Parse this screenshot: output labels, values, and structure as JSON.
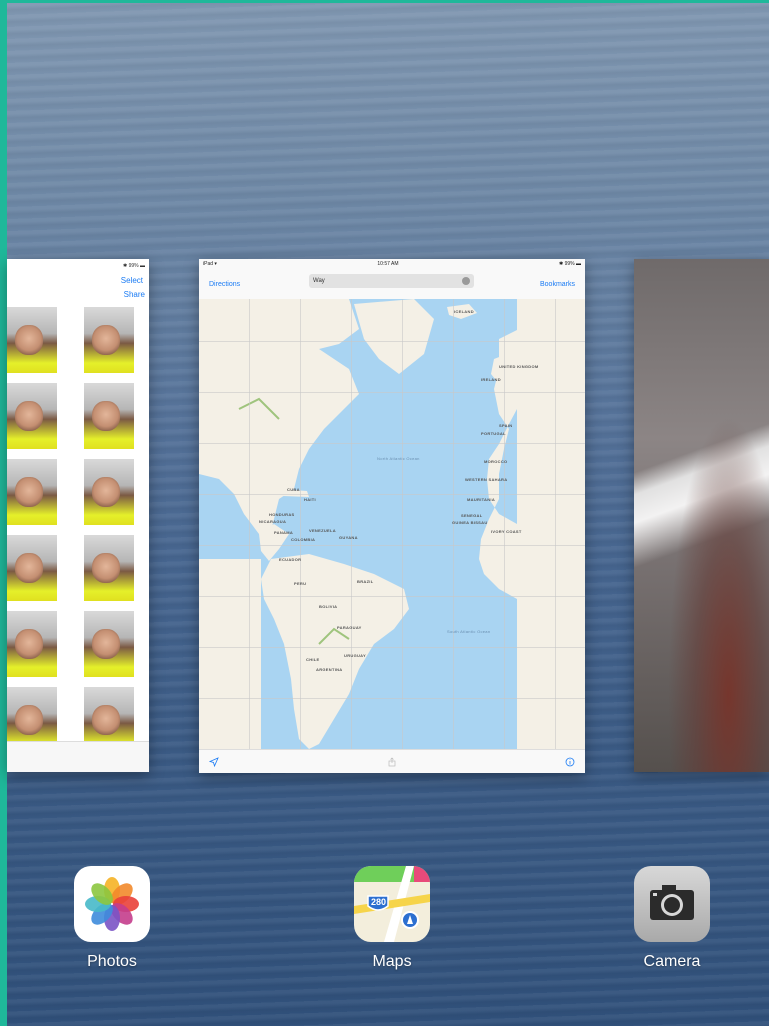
{
  "app_switcher": {
    "cards": {
      "photos": {
        "status_right": "✱ 99% ▬",
        "select_label": "Select",
        "share_label": "Share"
      },
      "maps": {
        "status_left": "iPad ▾",
        "status_time": "10:57 AM",
        "status_right": "✱ 99% ▬",
        "directions_label": "Directions",
        "search_value": "Way",
        "bookmarks_label": "Bookmarks",
        "map_labels": {
          "iceland": "ICELAND",
          "united_kingdom": "UNITED KINGDOM",
          "ireland": "IRELAND",
          "spain": "SPAIN",
          "portugal": "PORTUGAL",
          "morocco": "MOROCCO",
          "western_sahara": "WESTERN SAHARA",
          "mauritania": "MAURITANIA",
          "senegal": "SENEGAL",
          "guinea_bissau": "GUINEA BISSAU",
          "ivory_coast": "IVORY COAST",
          "north_atlantic": "North Atlantic Ocean",
          "south_atlantic": "South Atlantic Ocean",
          "cuba": "CUBA",
          "haiti": "HAITI",
          "honduras": "HONDURAS",
          "nicaragua": "NICARAGUA",
          "panama": "PANAMA",
          "venezuela": "VENEZUELA",
          "guyana": "GUYANA",
          "colombia": "COLOMBIA",
          "ecuador": "ECUADOR",
          "peru": "PERU",
          "brazil": "BRAZIL",
          "bolivia": "BOLIVIA",
          "paraguay": "PARAGUAY",
          "uruguay": "URUGUAY",
          "chile": "CHILE",
          "argentina": "ARGENTINA"
        }
      }
    },
    "dock": {
      "photos_label": "Photos",
      "maps_label": "Maps",
      "camera_label": "Camera",
      "maps_shield": "280"
    }
  }
}
